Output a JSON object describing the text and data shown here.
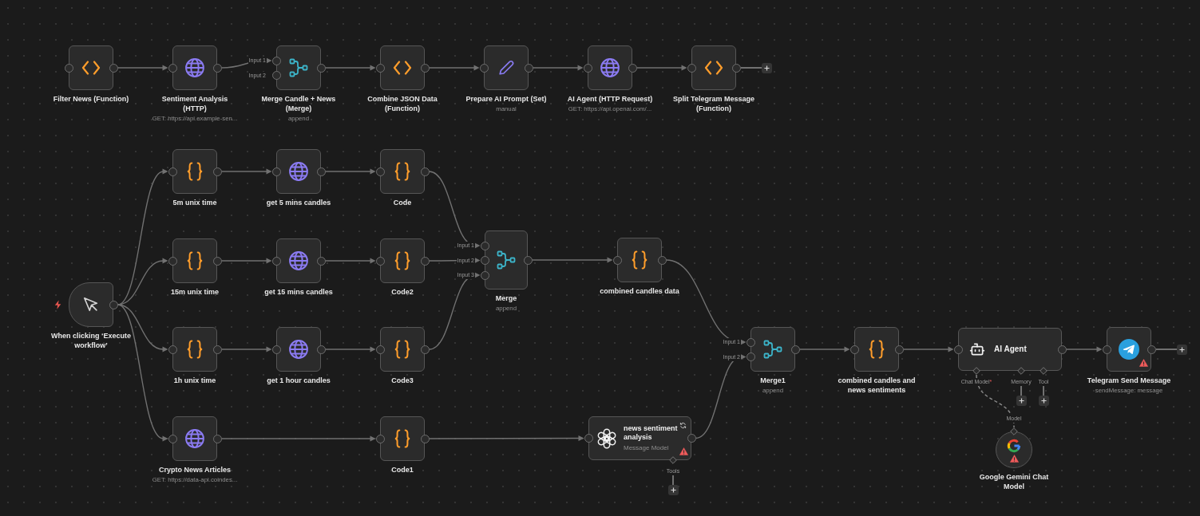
{
  "canvas": {
    "nodes": [
      {
        "kind": "function",
        "title": "Filter News (Function)",
        "warning": false,
        "open_output": false
      },
      {
        "kind": "http",
        "title": "Sentiment Analysis (HTTP)",
        "subtitle": "GET: https://api.example-sen...",
        "warning": false,
        "open_output": false
      },
      {
        "kind": "merge",
        "title": "Merge Candle + News (Merge)",
        "subtitle": "append",
        "inputs": [
          "Input 1",
          "Input 2"
        ],
        "warning": false,
        "open_output": false
      },
      {
        "kind": "function",
        "title": "Combine JSON Data (Function)",
        "warning": false,
        "open_output": false
      },
      {
        "kind": "set",
        "title": "Prepare AI Prompt (Set)",
        "subtitle": "manual",
        "warning": false,
        "open_output": false
      },
      {
        "kind": "http",
        "title": "AI Agent (HTTP Request)",
        "subtitle": "GET: https://api.openai.com/...",
        "warning": false,
        "open_output": false
      },
      {
        "kind": "function",
        "title": "Split Telegram Message (Function)",
        "warning": false,
        "open_output": true
      },
      {
        "kind": "code",
        "title": "5m unix time",
        "warning": false,
        "open_output": false
      },
      {
        "kind": "http",
        "title": "get 5 mins candles",
        "warning": false,
        "open_output": false
      },
      {
        "kind": "code",
        "title": "Code",
        "warning": false,
        "open_output": false
      },
      {
        "kind": "merge",
        "title": "Merge",
        "subtitle": "append",
        "inputs": [
          "Input 1",
          "Input 2",
          "Input 3"
        ],
        "warning": false,
        "open_output": false
      },
      {
        "kind": "code",
        "title": "15m unix time",
        "warning": false,
        "open_output": false
      },
      {
        "kind": "http",
        "title": "get 15 mins candles",
        "warning": false,
        "open_output": false
      },
      {
        "kind": "code",
        "title": "Code2",
        "warning": false,
        "open_output": false
      },
      {
        "kind": "code",
        "title": "combined candles data",
        "warning": false,
        "open_output": false
      },
      {
        "kind": "trigger",
        "title": "When clicking ‘Execute workflow’",
        "warning": false,
        "open_output": false
      },
      {
        "kind": "code",
        "title": "1h unix time",
        "warning": false,
        "open_output": false
      },
      {
        "kind": "http",
        "title": "get 1 hour candles",
        "warning": false,
        "open_output": false
      },
      {
        "kind": "code",
        "title": "Code3",
        "warning": false,
        "open_output": false
      },
      {
        "kind": "merge",
        "title": "Merge1",
        "subtitle": "append",
        "inputs": [
          "Input 1",
          "Input 2"
        ],
        "warning": false,
        "open_output": false
      },
      {
        "kind": "code",
        "title": "combined candles and news sentiments",
        "warning": false,
        "open_output": false
      },
      {
        "kind": "agent",
        "title": "AI Agent",
        "slots": [
          {
            "label": "Chat Model",
            "required_mark": "*",
            "connected": true
          },
          {
            "label": "Memory",
            "connected": false
          },
          {
            "label": "Tool",
            "connected": false
          }
        ],
        "warning": false,
        "open_output": false
      },
      {
        "kind": "telegram",
        "title": "Telegram Send Message",
        "subtitle": "sendMessage: message",
        "warning": true,
        "open_output": true
      },
      {
        "kind": "http",
        "title": "Crypto News Articles",
        "subtitle": "GET: https://data-api.coindes...",
        "warning": false,
        "open_output": false
      },
      {
        "kind": "code",
        "title": "Code1",
        "warning": false,
        "open_output": false
      },
      {
        "kind": "llm",
        "title": "news sentiment analysis",
        "subtitle": "Message Model",
        "slots": [
          {
            "label": "Tools",
            "connected": false
          }
        ],
        "warning": true,
        "open_output": false
      },
      {
        "kind": "model",
        "title": "Google Gemini Chat Model",
        "output_label": "Model",
        "warning": true,
        "open_output": false
      }
    ]
  }
}
